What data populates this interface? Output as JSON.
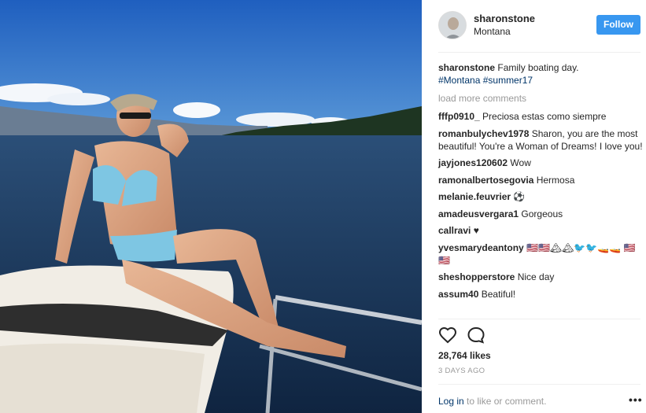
{
  "post": {
    "username": "sharonstone",
    "location": "Montana",
    "follow_label": "Follow",
    "caption_text": "Family boating day.",
    "hashtags": [
      "#Montana",
      "#summer17"
    ],
    "load_more": "load more comments",
    "comments": [
      {
        "user": "fffp0910_",
        "text": "Preciosa estas como siempre"
      },
      {
        "user": "romanbulychev1978",
        "text": "Sharon, you are the most beautiful! You're a Woman of Dreams! I love you!"
      },
      {
        "user": "jayjones120602",
        "text": "Wow"
      },
      {
        "user": "ramonalbertosegovia",
        "text": "Hermosa"
      },
      {
        "user": "melanie.feuvrier",
        "text": "⚽"
      },
      {
        "user": "amadeusvergara1",
        "text": "Gorgeous"
      },
      {
        "user": "callravi",
        "text": "♥"
      },
      {
        "user": "yvesmarydeantony",
        "text": "🇺🇸🇺🇸🏔🏔🐦🐦🚤🚤 🇺🇸🇺🇸"
      },
      {
        "user": "sheshopperstore",
        "text": "Nice day"
      },
      {
        "user": "assum40",
        "text": "Beatiful!"
      }
    ],
    "likes": "28,764 likes",
    "timestamp": "3 DAYS AGO",
    "login_link": "Log in",
    "login_rest": "to like or comment.",
    "more_options": "•••"
  },
  "icons": {
    "like": "heart-icon",
    "comment": "comment-bubble-icon",
    "more": "more-options-icon"
  },
  "colors": {
    "follow_bg": "#3897f0",
    "hashtag": "#003569",
    "muted": "#999999"
  }
}
